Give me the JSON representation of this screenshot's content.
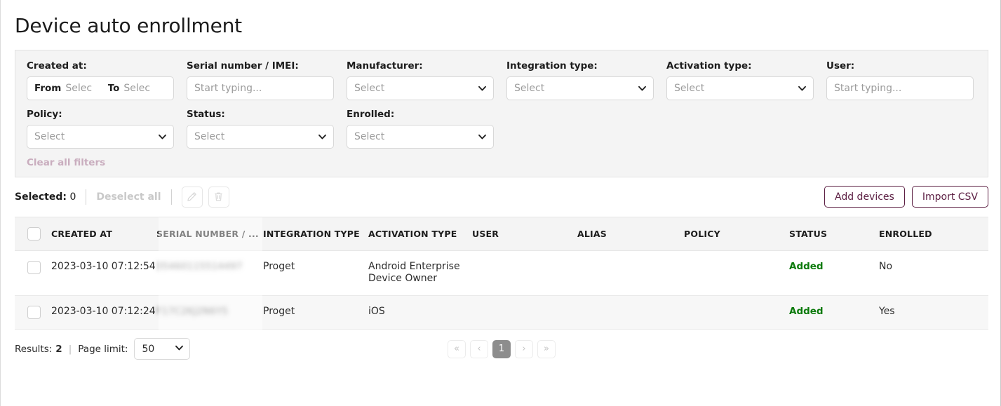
{
  "page": {
    "title": "Device auto enrollment"
  },
  "filters": {
    "created_at": {
      "label": "Created at:",
      "from_keyword": "From",
      "from_placeholder": "Selec",
      "to_keyword": "To",
      "to_placeholder": "Selec"
    },
    "serial": {
      "label": "Serial number / IMEI:",
      "placeholder": "Start typing..."
    },
    "manufacturer": {
      "label": "Manufacturer:",
      "value": "Select"
    },
    "integration_type": {
      "label": "Integration type:",
      "value": "Select"
    },
    "activation_type": {
      "label": "Activation type:",
      "value": "Select"
    },
    "user": {
      "label": "User:",
      "placeholder": "Start typing..."
    },
    "policy": {
      "label": "Policy:",
      "value": "Select"
    },
    "status": {
      "label": "Status:",
      "value": "Select"
    },
    "enrolled": {
      "label": "Enrolled:",
      "value": "Select"
    },
    "clear_all": "Clear all filters"
  },
  "toolbar": {
    "selected_label": "Selected:",
    "selected_count": "0",
    "deselect_all": "Deselect all",
    "edit_icon": "pencil-icon",
    "delete_icon": "trash-icon",
    "add_devices": "Add devices",
    "import_csv": "Import CSV"
  },
  "table": {
    "columns": [
      "CREATED AT",
      "SERIAL NUMBER / ...",
      "INTEGRATION TYPE",
      "ACTIVATION TYPE",
      "USER",
      "ALIAS",
      "POLICY",
      "STATUS",
      "ENROLLED"
    ],
    "rows": [
      {
        "created_at": "2023-03-10 07:12:54",
        "serial": "35460115514497",
        "integration_type": "Proget",
        "activation_type": "Android Enterprise Device Owner",
        "user": "",
        "alias": "",
        "policy": "",
        "status": "Added",
        "enrolled": "No"
      },
      {
        "created_at": "2023-03-10 07:12:24",
        "serial": "F17C2KJ2N6Y5",
        "integration_type": "Proget",
        "activation_type": "iOS",
        "user": "",
        "alias": "",
        "policy": "",
        "status": "Added",
        "enrolled": "Yes"
      }
    ]
  },
  "footer": {
    "results_label": "Results:",
    "results_count": "2",
    "separator": "|",
    "page_limit_label": "Page limit:",
    "page_limit_value": "50",
    "pager": {
      "first": "«",
      "prev": "‹",
      "current": "1",
      "next": "›",
      "last": "»"
    }
  },
  "colors": {
    "accent": "#5c1f43",
    "status_added": "#0b7a0b",
    "panel_bg": "#f4f4f4",
    "muted_link": "#c9adbe"
  }
}
